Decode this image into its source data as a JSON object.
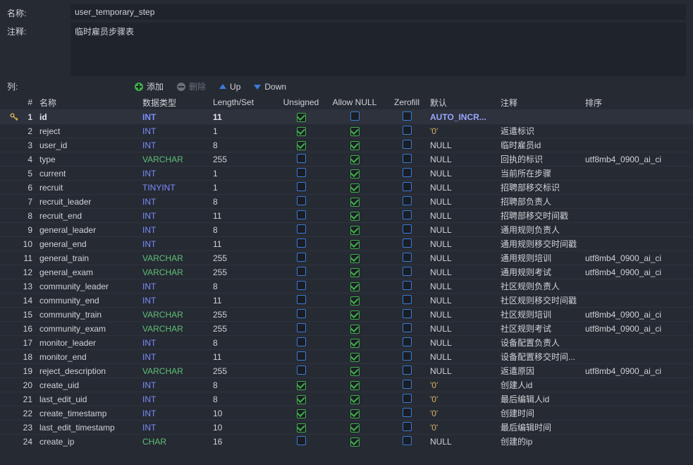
{
  "labels": {
    "name": "名称:",
    "comment": "注释:",
    "columns": "列:",
    "add": "添加",
    "remove": "删除",
    "up": "Up",
    "down": "Down"
  },
  "meta": {
    "name": "user_temporary_step",
    "comment": "临时雇员步骤表"
  },
  "headers": {
    "num": "#",
    "name": "名称",
    "type": "数据类型",
    "len": "Length/Set",
    "unsigned": "Unsigned",
    "allow_null": "Allow NULL",
    "zerofill": "Zerofill",
    "def": "默认",
    "comment": "注释",
    "collation": "排序"
  },
  "columns": [
    {
      "n": 1,
      "pk": true,
      "name": "id",
      "type": "INT",
      "len": "11",
      "unsigned": true,
      "null": false,
      "zero": false,
      "def_kind": "auto",
      "def": "AUTO_INCR...",
      "comment": "",
      "coll": ""
    },
    {
      "n": 2,
      "pk": false,
      "name": "reject",
      "type": "INT",
      "len": "1",
      "unsigned": true,
      "null": true,
      "zero": false,
      "def_kind": "str",
      "def": "'0'",
      "comment": "返遣标识",
      "coll": ""
    },
    {
      "n": 3,
      "pk": false,
      "name": "user_id",
      "type": "INT",
      "len": "8",
      "unsigned": true,
      "null": true,
      "zero": false,
      "def_kind": "null",
      "def": "NULL",
      "comment": "临时雇员id",
      "coll": ""
    },
    {
      "n": 4,
      "pk": false,
      "name": "type",
      "type": "VARCHAR",
      "len": "255",
      "unsigned": false,
      "null": true,
      "zero": false,
      "def_kind": "null",
      "def": "NULL",
      "comment": "回执的标识",
      "coll": "utf8mb4_0900_ai_ci"
    },
    {
      "n": 5,
      "pk": false,
      "name": "current",
      "type": "INT",
      "len": "1",
      "unsigned": false,
      "null": true,
      "zero": false,
      "def_kind": "null",
      "def": "NULL",
      "comment": "当前所在步骤",
      "coll": ""
    },
    {
      "n": 6,
      "pk": false,
      "name": "recruit",
      "type": "TINYINT",
      "len": "1",
      "unsigned": false,
      "null": true,
      "zero": false,
      "def_kind": "null",
      "def": "NULL",
      "comment": "招聘部移交标识",
      "coll": ""
    },
    {
      "n": 7,
      "pk": false,
      "name": "recruit_leader",
      "type": "INT",
      "len": "8",
      "unsigned": false,
      "null": true,
      "zero": false,
      "def_kind": "null",
      "def": "NULL",
      "comment": "招聘部负责人",
      "coll": ""
    },
    {
      "n": 8,
      "pk": false,
      "name": "recruit_end",
      "type": "INT",
      "len": "11",
      "unsigned": false,
      "null": true,
      "zero": false,
      "def_kind": "null",
      "def": "NULL",
      "comment": "招聘部移交时间戳",
      "coll": ""
    },
    {
      "n": 9,
      "pk": false,
      "name": "general_leader",
      "type": "INT",
      "len": "8",
      "unsigned": false,
      "null": true,
      "zero": false,
      "def_kind": "null",
      "def": "NULL",
      "comment": "通用规则负责人",
      "coll": ""
    },
    {
      "n": 10,
      "pk": false,
      "name": "general_end",
      "type": "INT",
      "len": "11",
      "unsigned": false,
      "null": true,
      "zero": false,
      "def_kind": "null",
      "def": "NULL",
      "comment": "通用规则移交时间戳",
      "coll": ""
    },
    {
      "n": 11,
      "pk": false,
      "name": "general_train",
      "type": "VARCHAR",
      "len": "255",
      "unsigned": false,
      "null": true,
      "zero": false,
      "def_kind": "null",
      "def": "NULL",
      "comment": "通用规则培训",
      "coll": "utf8mb4_0900_ai_ci"
    },
    {
      "n": 12,
      "pk": false,
      "name": "general_exam",
      "type": "VARCHAR",
      "len": "255",
      "unsigned": false,
      "null": true,
      "zero": false,
      "def_kind": "null",
      "def": "NULL",
      "comment": "通用规则考试",
      "coll": "utf8mb4_0900_ai_ci"
    },
    {
      "n": 13,
      "pk": false,
      "name": "community_leader",
      "type": "INT",
      "len": "8",
      "unsigned": false,
      "null": true,
      "zero": false,
      "def_kind": "null",
      "def": "NULL",
      "comment": "社区规则负责人",
      "coll": ""
    },
    {
      "n": 14,
      "pk": false,
      "name": "community_end",
      "type": "INT",
      "len": "11",
      "unsigned": false,
      "null": true,
      "zero": false,
      "def_kind": "null",
      "def": "NULL",
      "comment": "社区规则移交时间戳",
      "coll": ""
    },
    {
      "n": 15,
      "pk": false,
      "name": "community_train",
      "type": "VARCHAR",
      "len": "255",
      "unsigned": false,
      "null": true,
      "zero": false,
      "def_kind": "null",
      "def": "NULL",
      "comment": "社区规则培训",
      "coll": "utf8mb4_0900_ai_ci"
    },
    {
      "n": 16,
      "pk": false,
      "name": "community_exam",
      "type": "VARCHAR",
      "len": "255",
      "unsigned": false,
      "null": true,
      "zero": false,
      "def_kind": "null",
      "def": "NULL",
      "comment": "社区规则考试",
      "coll": "utf8mb4_0900_ai_ci"
    },
    {
      "n": 17,
      "pk": false,
      "name": "monitor_leader",
      "type": "INT",
      "len": "8",
      "unsigned": false,
      "null": true,
      "zero": false,
      "def_kind": "null",
      "def": "NULL",
      "comment": "设备配置负责人",
      "coll": ""
    },
    {
      "n": 18,
      "pk": false,
      "name": "monitor_end",
      "type": "INT",
      "len": "11",
      "unsigned": false,
      "null": true,
      "zero": false,
      "def_kind": "null",
      "def": "NULL",
      "comment": "设备配置移交时间...",
      "coll": ""
    },
    {
      "n": 19,
      "pk": false,
      "name": "reject_description",
      "type": "VARCHAR",
      "len": "255",
      "unsigned": false,
      "null": true,
      "zero": false,
      "def_kind": "null",
      "def": "NULL",
      "comment": "返遣原因",
      "coll": "utf8mb4_0900_ai_ci"
    },
    {
      "n": 20,
      "pk": false,
      "name": "create_uid",
      "type": "INT",
      "len": "8",
      "unsigned": true,
      "null": true,
      "zero": false,
      "def_kind": "str",
      "def": "'0'",
      "comment": "创建人id",
      "coll": ""
    },
    {
      "n": 21,
      "pk": false,
      "name": "last_edit_uid",
      "type": "INT",
      "len": "8",
      "unsigned": true,
      "null": true,
      "zero": false,
      "def_kind": "str",
      "def": "'0'",
      "comment": "最后编辑人id",
      "coll": ""
    },
    {
      "n": 22,
      "pk": false,
      "name": "create_timestamp",
      "type": "INT",
      "len": "10",
      "unsigned": true,
      "null": true,
      "zero": false,
      "def_kind": "str",
      "def": "'0'",
      "comment": "创建时间",
      "coll": ""
    },
    {
      "n": 23,
      "pk": false,
      "name": "last_edit_timestamp",
      "type": "INT",
      "len": "10",
      "unsigned": true,
      "null": true,
      "zero": false,
      "def_kind": "str",
      "def": "'0'",
      "comment": "最后编辑时间",
      "coll": ""
    },
    {
      "n": 24,
      "pk": false,
      "name": "create_ip",
      "type": "CHAR",
      "len": "16",
      "unsigned": false,
      "null": true,
      "zero": false,
      "def_kind": "null",
      "def": "NULL",
      "comment": "创建的ip",
      "coll": ""
    }
  ],
  "selected_row": 1
}
